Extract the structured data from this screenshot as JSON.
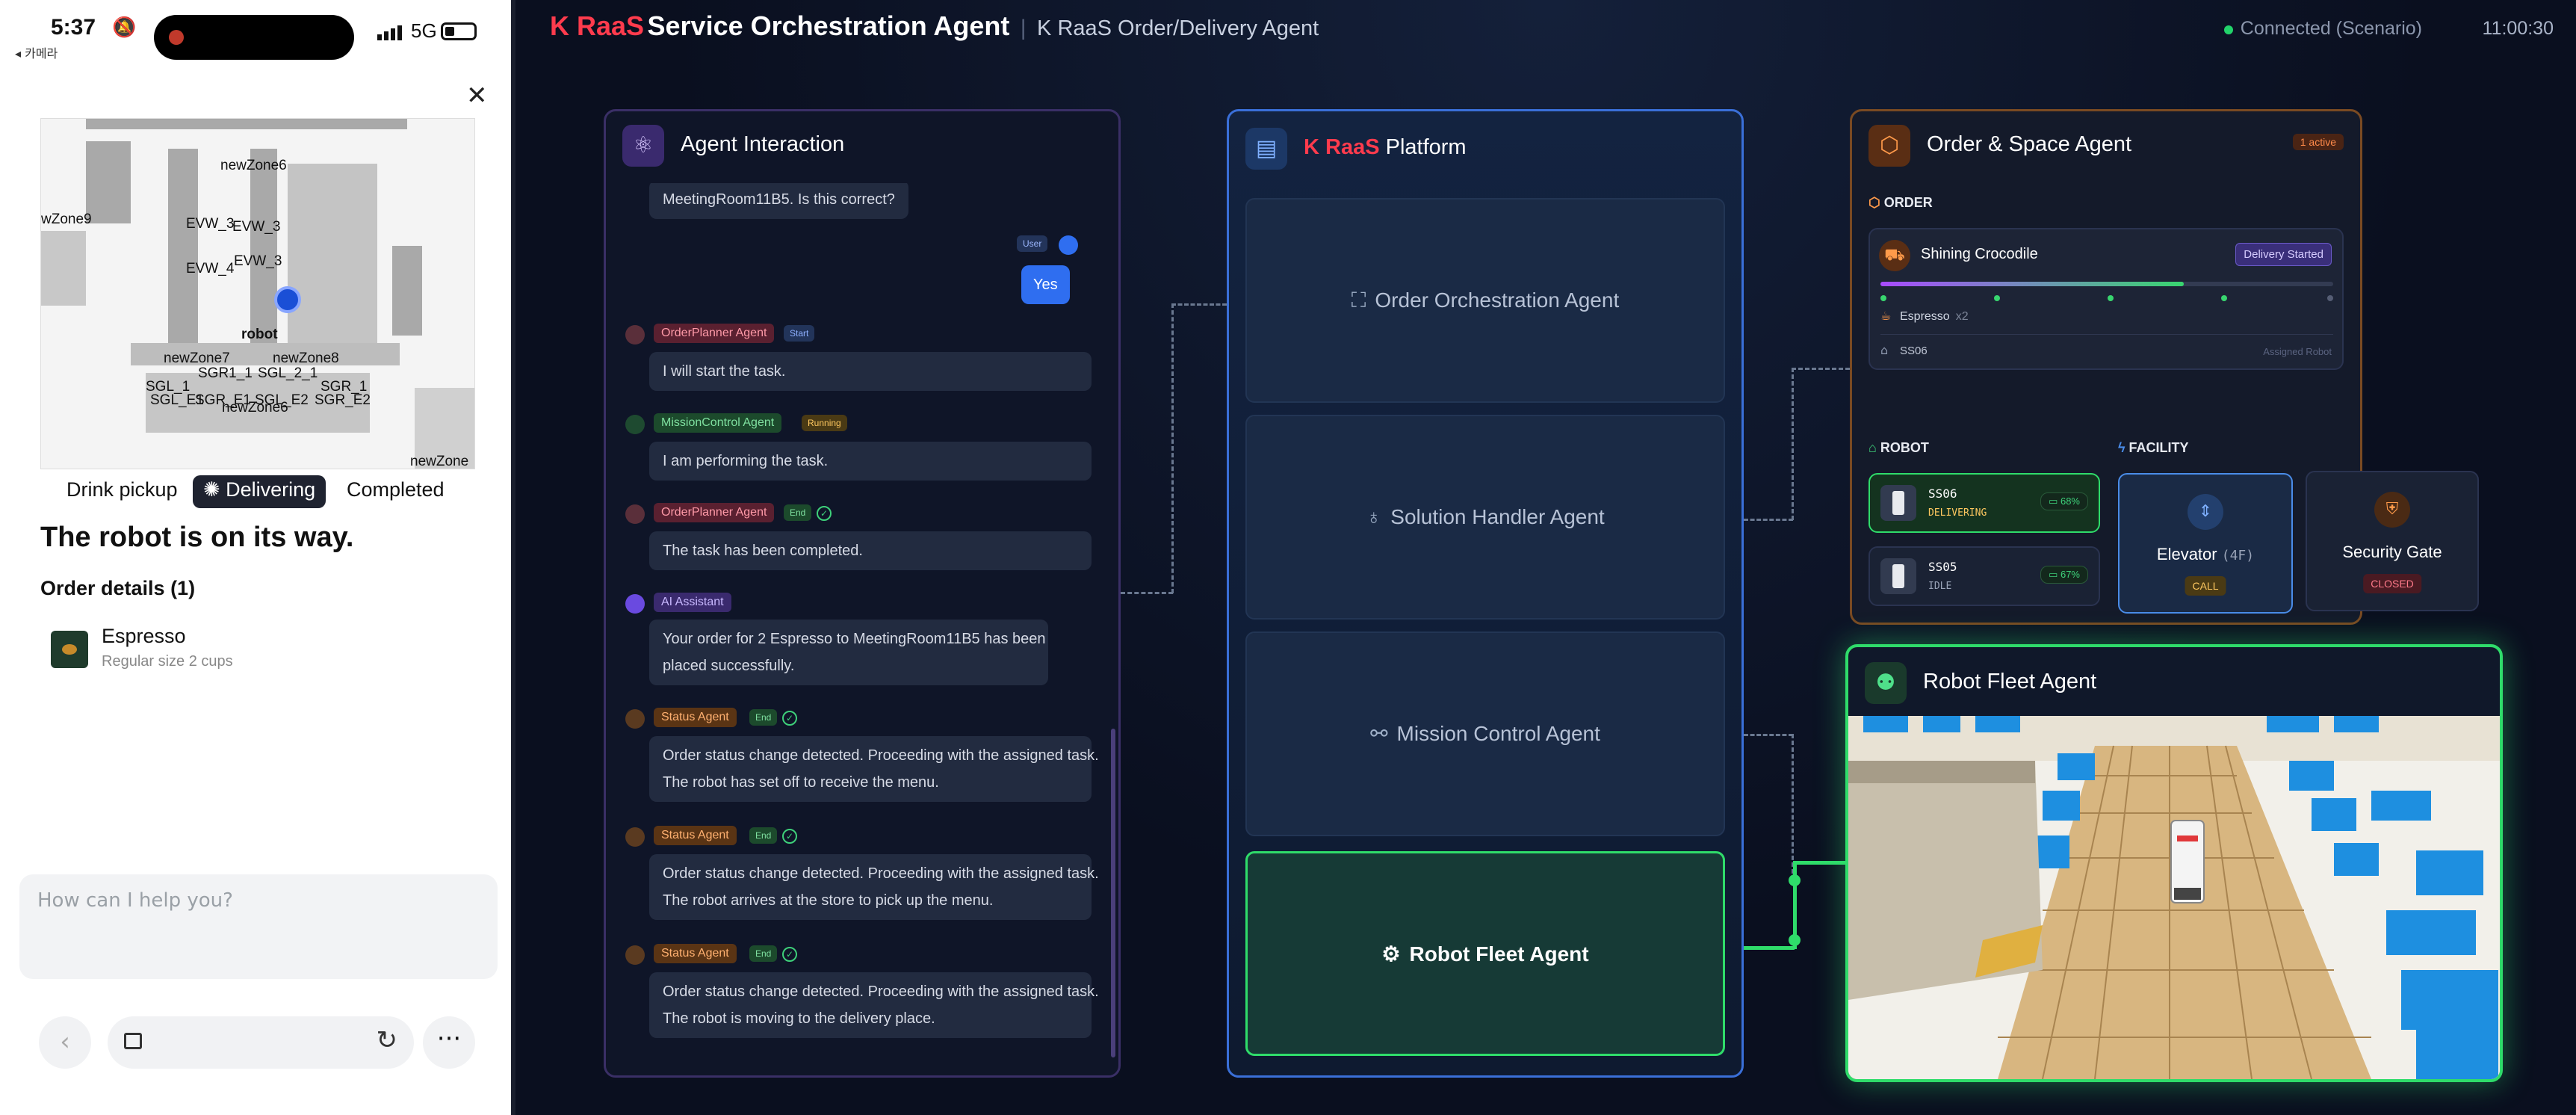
{
  "phone": {
    "time": "5:37",
    "network": "5G",
    "back_app": "◂ 카메라",
    "map_labels": [
      "newZone6",
      "wZone9",
      "EVW_3",
      "EVW_3",
      "EVW_3",
      "EVW_4",
      "robot",
      "newZone7",
      "newZone8",
      "SGR1_1",
      "SGL_2_1",
      "SGL_1",
      "SGL_E1",
      "SGR_E1",
      "SGL_E2",
      "SGR_E2",
      "SGR_1",
      "newZone6",
      "newZone"
    ],
    "tabs": [
      "Drink pickup",
      "Delivering",
      "Completed"
    ],
    "headline": "The robot is on its way.",
    "order_details": "Order details (1)",
    "product_name": "Espresso",
    "product_sub": "Regular size 2 cups",
    "chat_placeholder": "How can I help you?"
  },
  "header": {
    "brand": "K RaaS",
    "title": "Service Orchestration Agent",
    "subtitle": "K RaaS Order/Delivery Agent",
    "connection": "Connected (Scenario)",
    "clock": "11:00:30"
  },
  "agent_interaction": {
    "title": "Agent Interaction",
    "messages": [
      {
        "text": "MeetingRoom11B5. Is this correct?"
      },
      {
        "user_tag": "User",
        "text": "Yes"
      },
      {
        "agent": "OrderPlanner Agent",
        "state": "Start",
        "text": "I will start the task."
      },
      {
        "agent": "MissionControl Agent",
        "state": "Running",
        "text": "I am performing the task."
      },
      {
        "agent": "OrderPlanner Agent",
        "state": "End",
        "text": "The task has been completed."
      },
      {
        "agent": "AI Assistant",
        "lines": [
          "Your order for 2 Espresso to MeetingRoom11B5 has been",
          "placed successfully."
        ]
      },
      {
        "agent": "Status Agent",
        "state": "End",
        "lines": [
          "Order status change detected. Proceeding with the assigned task.",
          "The robot has set off to receive the menu."
        ]
      },
      {
        "agent": "Status Agent",
        "state": "End",
        "lines": [
          "Order status change detected. Proceeding with the assigned task.",
          "The robot arrives at the store to pick up the menu."
        ]
      },
      {
        "agent": "Status Agent",
        "state": "End",
        "lines": [
          "Order status change detected. Proceeding with the assigned task.",
          "The robot is moving to the delivery place."
        ]
      }
    ]
  },
  "platform": {
    "brand": "K RaaS",
    "title": "Platform",
    "agents": [
      "Order Orchestration Agent",
      "Solution Handler Agent",
      "Mission Control Agent",
      "Robot Fleet Agent"
    ],
    "active_agent_index": 3
  },
  "order_space": {
    "title": "Order & Space Agent",
    "active_badge": "1 active",
    "order_heading": "ORDER",
    "customer": "Shining Crocodile",
    "status_badge": "Delivery Started",
    "progress": 0.67,
    "item": "Espresso",
    "qty": "x2",
    "robot_id": "SS06",
    "assigned_label": "Assigned Robot",
    "robot_heading": "ROBOT",
    "facility_heading": "FACILITY",
    "robots": [
      {
        "id": "SS06",
        "status": "DELIVERING",
        "battery": "68%"
      },
      {
        "id": "SS05",
        "status": "IDLE",
        "battery": "67%"
      }
    ],
    "facilities": [
      {
        "name": "Elevator",
        "floor": "(4F)",
        "state": "CALL"
      },
      {
        "name": "Security Gate",
        "floor": "",
        "state": "CLOSED"
      }
    ]
  },
  "robot_fleet": {
    "title": "Robot Fleet Agent"
  },
  "colors": {
    "brand_red": "#ff3b4d",
    "active_green": "#2fdc6a",
    "platform_blue": "#3a6fd8",
    "order_orange": "#ff9a4a"
  }
}
